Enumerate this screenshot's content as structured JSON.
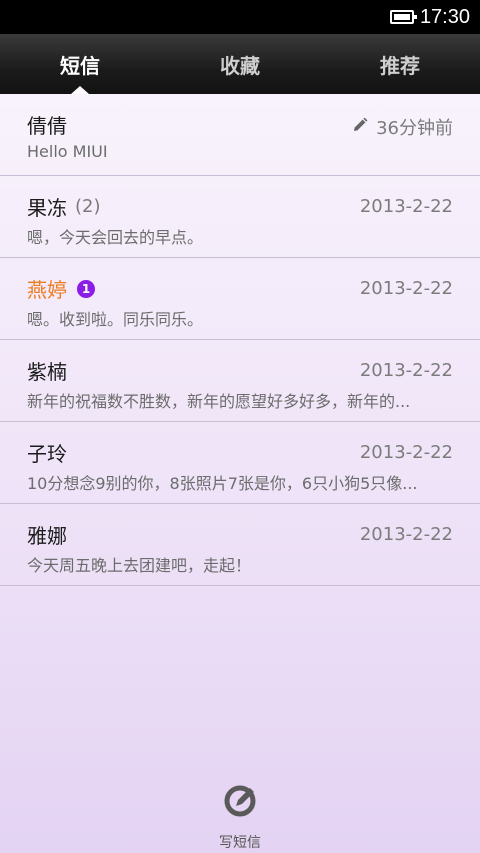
{
  "status_bar": {
    "time": "17:30",
    "battery_icon": "battery-icon"
  },
  "tabs": [
    {
      "label": "短信",
      "active": true
    },
    {
      "label": "收藏",
      "active": false
    },
    {
      "label": "推荐",
      "active": false
    }
  ],
  "messages": [
    {
      "name": "倩倩",
      "count": "",
      "badge": "",
      "date": "36分钟前",
      "preview": "Hello MIUI",
      "draft": true,
      "unread": false
    },
    {
      "name": "果冻",
      "count": "(2)",
      "badge": "",
      "date": "2013-2-22",
      "preview": "嗯，今天会回去的早点。",
      "draft": false,
      "unread": false
    },
    {
      "name": "燕婷",
      "count": "",
      "badge": "1",
      "date": "2013-2-22",
      "preview": "嗯。收到啦。同乐同乐。",
      "draft": false,
      "unread": true
    },
    {
      "name": "紫楠",
      "count": "",
      "badge": "",
      "date": "2013-2-22",
      "preview": "新年的祝福数不胜数，新年的愿望好多好多，新年的...",
      "draft": false,
      "unread": false
    },
    {
      "name": "子玲",
      "count": "",
      "badge": "",
      "date": "2013-2-22",
      "preview": "10分想念9别的你，8张照片7张是你，6只小狗5只像...",
      "draft": false,
      "unread": false
    },
    {
      "name": "雅娜",
      "count": "",
      "badge": "",
      "date": "2013-2-22",
      "preview": "今天周五晚上去团建吧，走起！",
      "draft": false,
      "unread": false
    }
  ],
  "compose": {
    "label": "写短信",
    "icon": "compose-icon"
  },
  "colors": {
    "unread_name": "#ee7b1e",
    "badge": "#8a1ee6",
    "tab_bar": "#1b1b1b"
  }
}
